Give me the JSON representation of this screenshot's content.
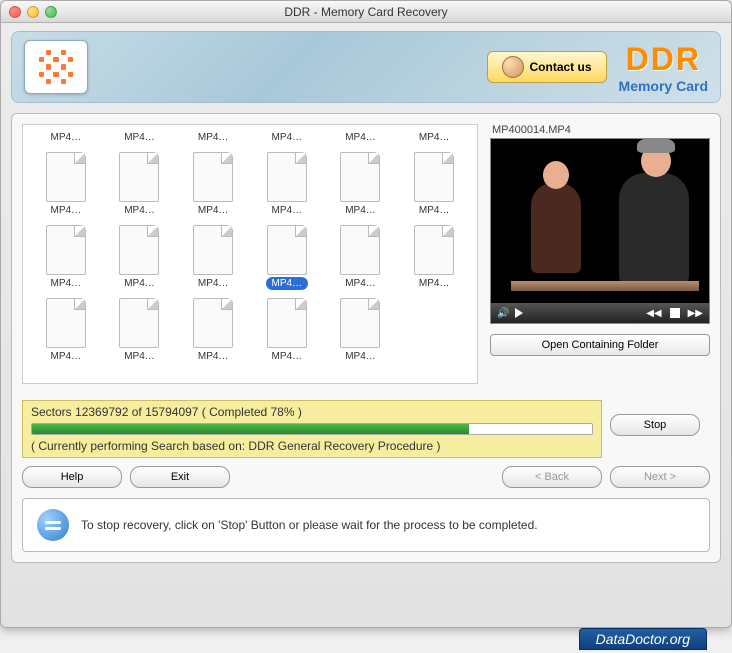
{
  "window": {
    "title": "DDR - Memory Card Recovery"
  },
  "header": {
    "contact_label": "Contact us",
    "brand_top": "DDR",
    "brand_sub": "Memory Card"
  },
  "files": {
    "row0": [
      "MP4…",
      "MP4…",
      "MP4…",
      "MP4…",
      "MP4…",
      "MP4…"
    ],
    "row1": [
      "MP4…",
      "MP4…",
      "MP4…",
      "MP4…",
      "MP4…",
      "MP4…"
    ],
    "row2": [
      "MP4…",
      "MP4…",
      "MP4…",
      "MP4…",
      "MP4…",
      "MP4…"
    ],
    "row3": [
      "MP4…",
      "MP4…",
      "MP4…",
      "MP4…",
      "MP4…",
      ""
    ],
    "selected_index": 15
  },
  "preview": {
    "filename": "MP400014.MP4",
    "open_folder_label": "Open Containing Folder"
  },
  "progress": {
    "sectors_current": "12369792",
    "sectors_total": "15794097",
    "percent": 78,
    "line1": "Sectors 12369792 of 15794097   ( Completed 78% )",
    "line2": "( Currently performing Search based on: DDR General Recovery Procedure )"
  },
  "buttons": {
    "stop": "Stop",
    "help": "Help",
    "exit": "Exit",
    "back": "< Back",
    "next": "Next >"
  },
  "hint": {
    "text": "To stop recovery, click on 'Stop' Button or please wait for the process to be completed."
  },
  "footer": {
    "text": "DataDoctor.org"
  }
}
